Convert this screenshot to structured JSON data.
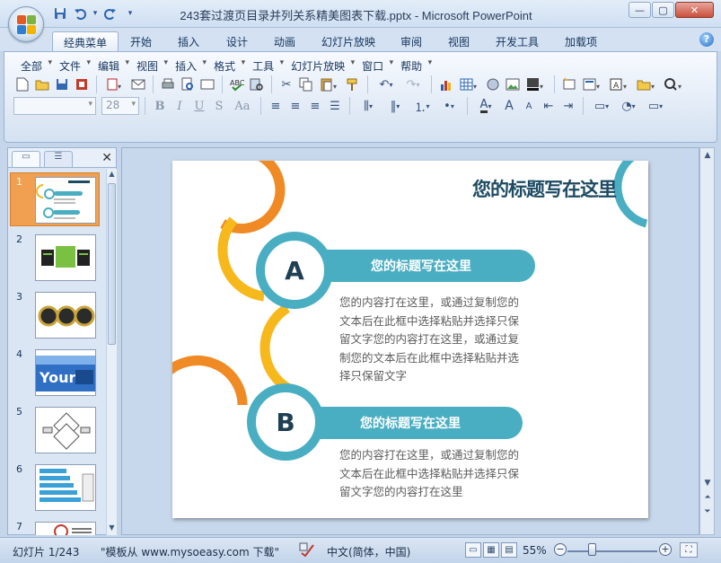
{
  "window": {
    "title": "243套过渡页目录并列关系精美图表下载.pptx - Microsoft PowerPoint",
    "controls": {
      "minimize": "—",
      "maximize": "▢",
      "close": "✕"
    }
  },
  "quick_access": {
    "save": "💾",
    "undo": "↶",
    "redo": "↷",
    "customize": "▾"
  },
  "tabs": [
    {
      "label": "经典菜单"
    },
    {
      "label": "开始"
    },
    {
      "label": "插入"
    },
    {
      "label": "设计"
    },
    {
      "label": "动画"
    },
    {
      "label": "幻灯片放映"
    },
    {
      "label": "审阅"
    },
    {
      "label": "视图"
    },
    {
      "label": "开发工具"
    },
    {
      "label": "加载项"
    }
  ],
  "help": "?",
  "menus": [
    {
      "label": "全部"
    },
    {
      "label": "文件"
    },
    {
      "label": "编辑"
    },
    {
      "label": "视图"
    },
    {
      "label": "插入"
    },
    {
      "label": "格式"
    },
    {
      "label": "工具"
    },
    {
      "label": "幻灯片放映"
    },
    {
      "label": "窗口"
    },
    {
      "label": "帮助"
    }
  ],
  "formatting": {
    "font_name": "",
    "font_size": "28",
    "bold": "B",
    "italic": "I",
    "underline": "U",
    "shadow": "S",
    "case": "Aa"
  },
  "pane": {
    "close": "✕",
    "slides": [
      {
        "number": "1"
      },
      {
        "number": "2"
      },
      {
        "number": "3"
      },
      {
        "number": "4"
      },
      {
        "number": "5"
      },
      {
        "number": "6"
      },
      {
        "number": "7"
      }
    ]
  },
  "slide": {
    "title": "您的标题写在这里",
    "items": [
      {
        "letter": "A",
        "heading": "您的标题写在这里",
        "body": "您的内容打在这里，或通过复制您的文本后在此框中选择粘贴并选择只保留文字您的内容打在这里，或通过复制您的文本后在此框中选择粘贴并选择只保留文字"
      },
      {
        "letter": "B",
        "heading": "您的标题写在这里",
        "body": "您的内容打在这里，或通过复制您的文本后在此框中选择粘贴并选择只保留文字您的内容打在这里"
      }
    ],
    "colors": {
      "teal": "#4aaec3",
      "yellow": "#f7b81c",
      "orange": "#ef8a24",
      "title": "#1d4b63"
    }
  },
  "status": {
    "slide_info": "幻灯片 1/243",
    "template": "\"模板从 www.mysoeasy.com 下载\"",
    "language": "中文(简体，中国)",
    "zoom": "55%",
    "zoom_minus": "−",
    "zoom_plus": "+"
  }
}
